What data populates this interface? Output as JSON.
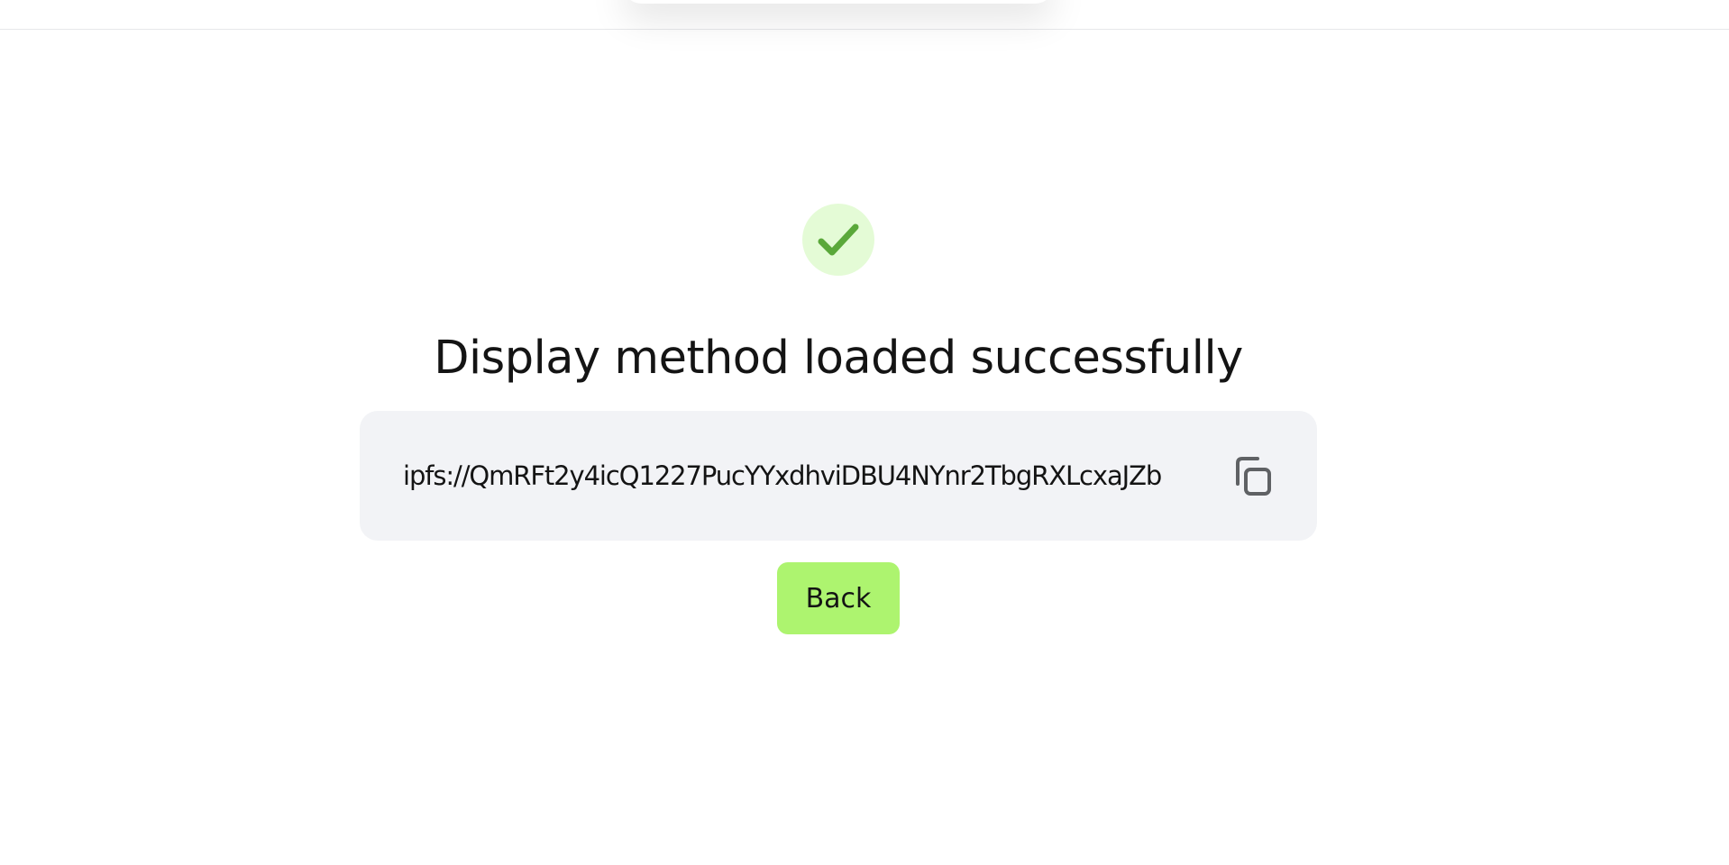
{
  "status": {
    "icon": "checkmark-icon",
    "title": "Display method loaded successfully"
  },
  "uri": {
    "value": "ipfs://QmRFt2y4icQ1227PucYYxdhviDBU4NYnr2TbgRXLcxaJZb",
    "copy_icon": "copy-icon"
  },
  "actions": {
    "back_label": "Back"
  },
  "colors": {
    "accent": "#adf46f",
    "success_bg": "#e4fbd6",
    "success_check": "#5aa83a",
    "panel_bg": "#f2f3f6",
    "text": "#141414",
    "icon_gray": "#5f6164"
  }
}
